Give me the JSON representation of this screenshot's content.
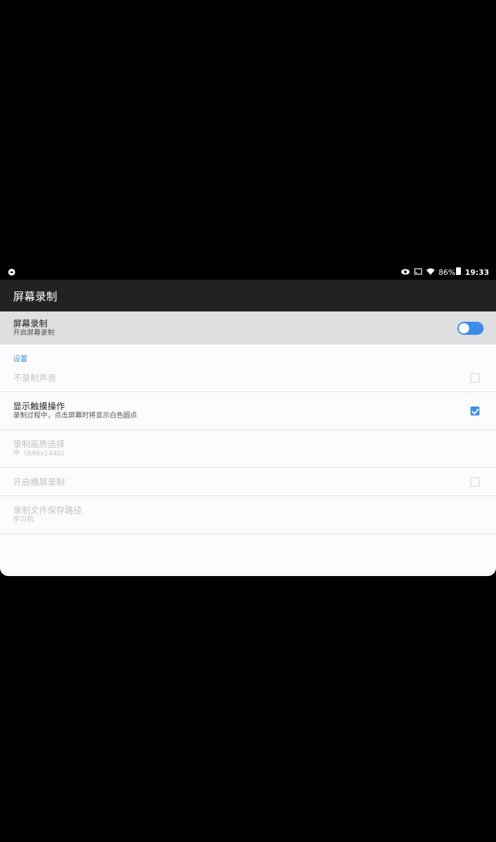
{
  "status_bar": {
    "battery": "86%",
    "time": "19:33",
    "icons": [
      "notification-icon",
      "eye-icon",
      "cast-icon",
      "wifi-icon",
      "battery-icon"
    ]
  },
  "app_bar": {
    "title": "屏幕录制"
  },
  "master": {
    "title": "屏幕录制",
    "summary": "开启屏幕录制",
    "enabled": false
  },
  "settings": {
    "header": "设置",
    "mute": {
      "title": "不录制声音",
      "checked": false,
      "enabled": false
    },
    "touches": {
      "title": "显示触摸操作",
      "summary": "录制过程中，点击屏幕时将显示白色圆点",
      "checked": true,
      "enabled": true
    },
    "quality": {
      "title": "录制画质选择",
      "summary": "中（846x1440）",
      "enabled": false
    },
    "landscape": {
      "title": "开启横屏录制",
      "checked": false,
      "enabled": false
    },
    "path": {
      "title": "录制文件保存路径",
      "summary": "学习机",
      "enabled": false
    }
  },
  "colors": {
    "accent": "#3d8de8",
    "app_bar": "#222222",
    "master_bg": "#dfdfe1"
  }
}
